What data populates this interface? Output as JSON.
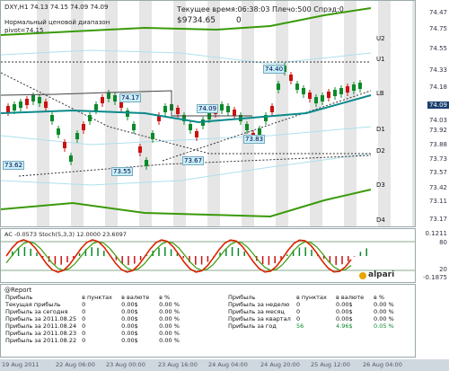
{
  "header": {
    "symbol_line": "DXY,H1  74.13 74.15 74.09 74.09",
    "indicator_title": "Нормальный ценовой диапазон",
    "pivot": "pivot=74.15",
    "server_time": "Текущее время:06:38:03 Плечо:500 Спрэд:0",
    "balance": "$9734.65",
    "pct": "0"
  },
  "price_axis": {
    "ticks": [
      "74.47",
      "74.33",
      "74.18",
      "74.03",
      "73.88",
      "73.73",
      "73.57",
      "73.42",
      "73.27",
      "73.13",
      "74.55",
      "74.75",
      "73.11",
      "73.92",
      "73.17"
    ],
    "current": "74.09",
    "zone_labels": [
      "R2",
      "R1",
      "S1",
      "S2",
      "S3",
      "S4"
    ]
  },
  "levels": {
    "U2": "U2",
    "U1": "U1",
    "LB": "LB",
    "D1": "D1",
    "D2": "D2",
    "D3": "D3",
    "D4": "D4"
  },
  "price_labels": [
    "74.40",
    "74.17",
    "74.09",
    "73.83",
    "73.67",
    "73.55",
    "73.62"
  ],
  "indicator": {
    "title": "AC -0.0573  Stoch(5,3,3) 12.0000  23.6097",
    "axis_top": "0.1211",
    "axis_bottom": "-0.1875",
    "lvl_80": "80",
    "lvl_20": "20"
  },
  "report": {
    "title": "@Report",
    "col_points": "в пунктах",
    "col_currency": "в валюте",
    "col_pct": "в %",
    "left_rows": [
      {
        "label": "Прибыль",
        "pts": "",
        "cur": "",
        "pct": ""
      },
      {
        "label": "Текущая прибыль",
        "pts": "0",
        "cur": "0.00$",
        "pct": "0.00 %"
      },
      {
        "label": "Прибыль за сегодня",
        "pts": "0",
        "cur": "0.00$",
        "pct": "0.00 %"
      },
      {
        "label": "Прибыль за 2011.08.25",
        "pts": "0",
        "cur": "0.00$",
        "pct": "0.00 %"
      },
      {
        "label": "Прибыль за 2011.08.24",
        "pts": "0",
        "cur": "0.00$",
        "pct": "0.00 %"
      },
      {
        "label": "Прибыль за 2011.08.23",
        "pts": "0",
        "cur": "0.00$",
        "pct": "0.00 %"
      },
      {
        "label": "Прибыль за 2011.08.22",
        "pts": "0",
        "cur": "0.00$",
        "pct": "0.00 %"
      }
    ],
    "right_rows": [
      {
        "label": "Прибыль",
        "pts": "в пунктах",
        "cur": "в валюте",
        "pct": "в %"
      },
      {
        "label": "Прибыль за неделю",
        "pts": "0",
        "cur": "0.00$",
        "pct": "0.00 %"
      },
      {
        "label": "Прибыль за месяц",
        "pts": "0",
        "cur": "0.00$",
        "pct": "0.00 %"
      },
      {
        "label": "Прибыль за квартал",
        "pts": "0",
        "cur": "0.00$",
        "pct": "0.00 %"
      },
      {
        "label": "Прибыль за год",
        "pts": "56",
        "cur": "4.96$",
        "pct": "0.05 %"
      }
    ]
  },
  "brand": "alpari",
  "timebar": [
    "19 Aug 2011",
    "22 Aug 06:00",
    "23 Aug 00:00",
    "23 Aug 16:00",
    "24 Aug 04:00",
    "24 Aug 20:00",
    "25 Aug 12:00",
    "26 Aug 04:00"
  ],
  "colors": {
    "up_candle": "#0a8a2a",
    "down_candle": "#cc1111",
    "ma": "#0b8a8a",
    "band": "#3a9a0a",
    "stoch": "#dd2200",
    "stoch_signal": "#3a9a0a"
  }
}
